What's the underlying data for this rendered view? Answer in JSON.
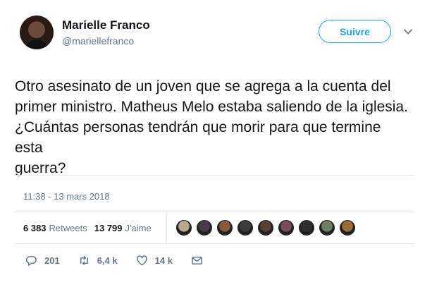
{
  "author": {
    "name": "Marielle Franco",
    "handle": "@mariellefranco"
  },
  "follow_button": {
    "label": "Suivre"
  },
  "tweet": {
    "lines": [
      "Otro asesinato de un joven que se agrega a la cuenta del",
      "primer ministro. Matheus Melo estaba saliendo de la iglesia.",
      "¿Cuántas personas tendrán que morir para que termine esta",
      "guerra?"
    ]
  },
  "timestamp": "11:38 - 13 mars 2018",
  "stats": {
    "retweets_count": "6 383",
    "retweets_label": "Retweets",
    "likes_count": "13 799",
    "likes_label": "J'aime"
  },
  "liker_avatars": [
    {
      "color": "#b9a88e"
    },
    {
      "color": "#4a3b4a"
    },
    {
      "color": "#8b5a3c"
    },
    {
      "color": "#3c3c3c"
    },
    {
      "color": "#5a4030"
    },
    {
      "color": "#7a4b5c"
    },
    {
      "color": "#2e2e2e"
    },
    {
      "color": "#6e7a6a"
    },
    {
      "color": "#9a6a3a"
    }
  ],
  "actions": {
    "reply_count": "201",
    "retweet_count": "6,4 k",
    "like_count": "14 k"
  },
  "icons": {
    "caret": "chevron-down-icon",
    "reply": "reply-icon",
    "retweet": "retweet-icon",
    "like": "heart-icon",
    "message": "envelope-icon"
  }
}
